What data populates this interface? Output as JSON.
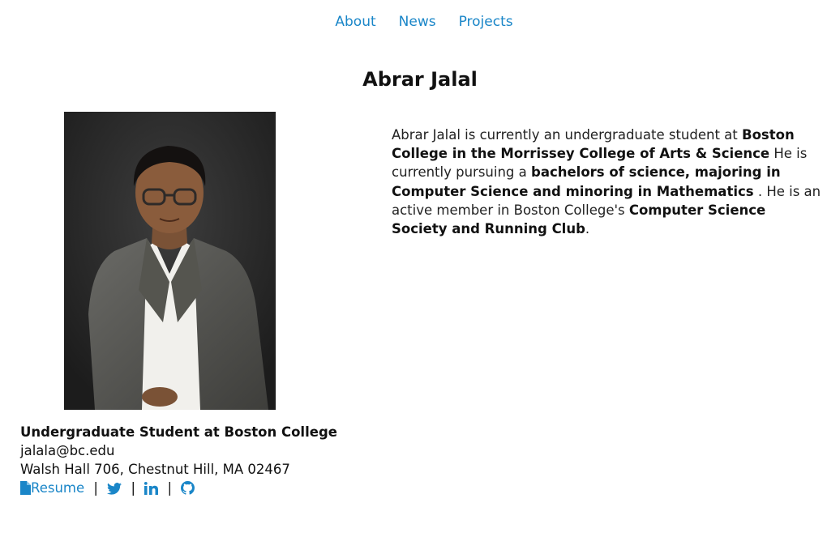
{
  "nav": {
    "items": [
      {
        "label": "About"
      },
      {
        "label": "News"
      },
      {
        "label": "Projects"
      }
    ]
  },
  "page": {
    "title": "Abrar Jalal"
  },
  "bio": {
    "t1": "Abrar Jalal is currently an undergraduate student at ",
    "b1": "Boston College in the Morrissey College of Arts & Science",
    "t2": " He is currently pursuing a ",
    "b2": "bachelors of science, majoring in Computer Science and minoring in Mathematics",
    "t3": " . He is an active member in Boston College's ",
    "b3": "Computer Science Society and Running Club",
    "t4": "."
  },
  "profile": {
    "role": "Undergraduate Student at Boston College",
    "email": "jalala@bc.edu",
    "address": "Walsh Hall 706, Chestnut Hill, MA 02467",
    "resume_label": "Resume",
    "separator": "|"
  },
  "icons": {
    "resume": "file-icon",
    "twitter": "twitter-icon",
    "linkedin": "linkedin-icon",
    "github": "github-icon"
  },
  "colors": {
    "link": "#1a86c8",
    "text": "#111111"
  }
}
